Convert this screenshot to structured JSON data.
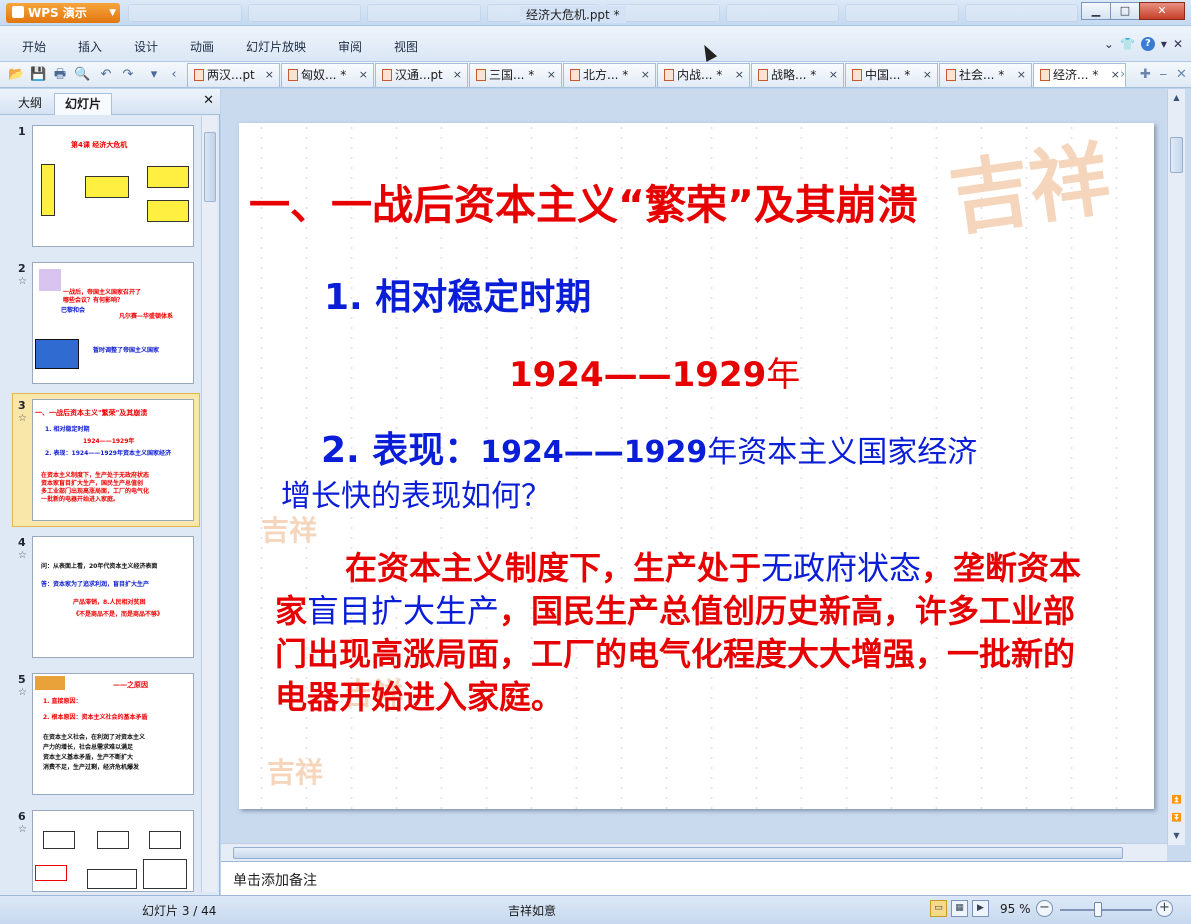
{
  "app": {
    "badge": "WPS 演示",
    "window_title": "经济大危机.ppt *"
  },
  "menu": [
    "开始",
    "插入",
    "设计",
    "动画",
    "幻灯片放映",
    "审阅",
    "视图"
  ],
  "doc_tabs": [
    {
      "label": "两汉...pt",
      "active": false
    },
    {
      "label": "匈奴... *",
      "active": false
    },
    {
      "label": "汉通...pt",
      "active": false
    },
    {
      "label": "三国... *",
      "active": false
    },
    {
      "label": "北方... *",
      "active": false
    },
    {
      "label": "内战... *",
      "active": false
    },
    {
      "label": "战略... *",
      "active": false
    },
    {
      "label": "中国... *",
      "active": false
    },
    {
      "label": "社会... *",
      "active": false
    },
    {
      "label": "经济... *",
      "active": true
    }
  ],
  "panel": {
    "tab_outline": "大纲",
    "tab_slides": "幻灯片",
    "thumbnails": [
      {
        "num": "1",
        "star": ""
      },
      {
        "num": "2",
        "star": "☆"
      },
      {
        "num": "3",
        "star": "☆"
      },
      {
        "num": "4",
        "star": "☆"
      },
      {
        "num": "5",
        "star": "☆"
      },
      {
        "num": "6",
        "star": "☆"
      }
    ],
    "selected_index": 3
  },
  "slide": {
    "title": "一、一战后资本主义“繁荣”及其崩溃",
    "sub1": "1. 相对稳定时期",
    "years_range": "1924——1929",
    "years_suffix": "年",
    "sub2_label": "2. 表现：",
    "sub2_years": "1924——1929",
    "sub2_text": "年资本主义国家经济",
    "sub2_question": "增长快的表现如何？",
    "para_part1": "在资本主义制度下，生产处于",
    "para_blue1": "无政府状态",
    "para_part2": "，垄断资本家",
    "para_blue2": "盲目扩大生产",
    "para_part3": "，国民生产总值创历史新高，许多工业部门出现高涨局面，工厂的电气化程度大大增强，一批新的电器开始进入家庭。"
  },
  "notes_placeholder": "单击添加备注",
  "status": {
    "slide_info": "幻灯片 3 / 44",
    "theme": "吉祥如意",
    "zoom": "95 %"
  }
}
